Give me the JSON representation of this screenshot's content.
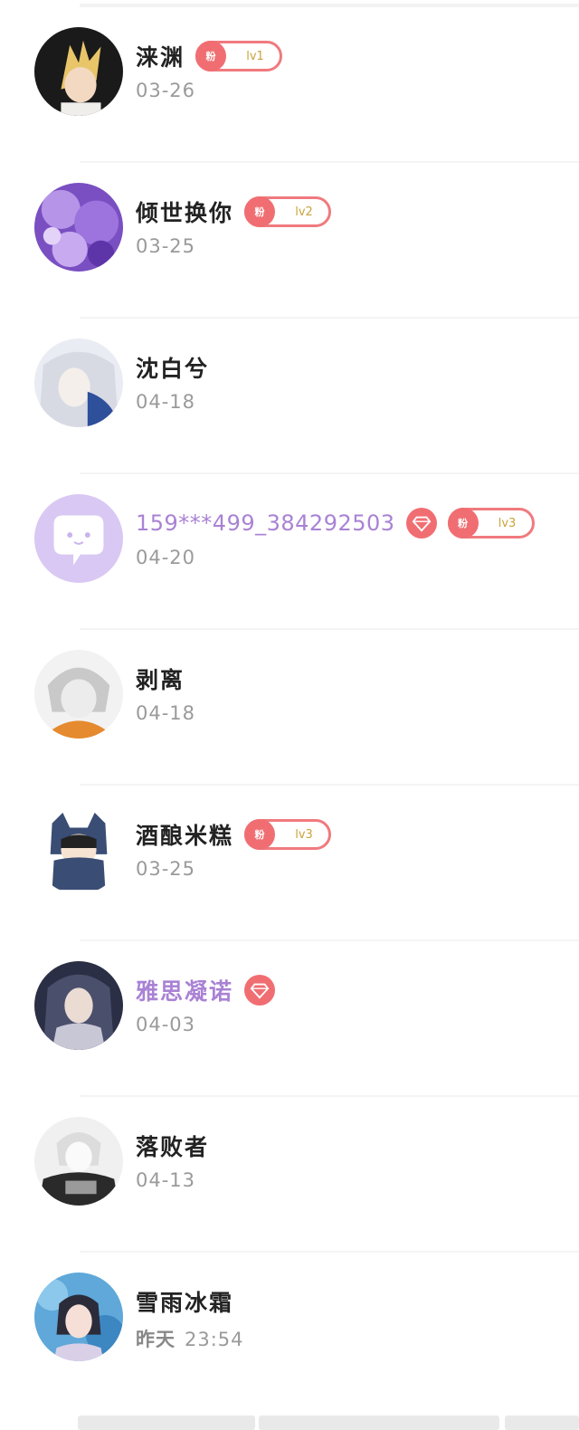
{
  "list": {
    "items": [
      {
        "name": "涞渊",
        "date": "03-26",
        "date_prefix": "",
        "fan_icon": "粉",
        "level": "lv1",
        "vip": false,
        "avatar": "avatar-blonde-anime"
      },
      {
        "name": "倾世换你",
        "date": "03-25",
        "date_prefix": "",
        "fan_icon": "粉",
        "level": "lv2",
        "vip": false,
        "avatar": "avatar-purple-blossoms"
      },
      {
        "name": "沈白兮",
        "date": "04-18",
        "date_prefix": "",
        "fan_icon": "",
        "level": "",
        "vip": false,
        "avatar": "avatar-white-hair-anime"
      },
      {
        "name": "159***499_384292503",
        "date": "04-20",
        "date_prefix": "",
        "fan_icon": "粉",
        "level": "lv3",
        "vip": true,
        "avatar": "avatar-default-chat-bubble"
      },
      {
        "name": "剥离",
        "date": "04-18",
        "date_prefix": "",
        "fan_icon": "",
        "level": "",
        "vip": false,
        "avatar": "avatar-grey-hair-anime"
      },
      {
        "name": "酒酿米糕",
        "date": "03-25",
        "date_prefix": "",
        "fan_icon": "粉",
        "level": "lv3",
        "vip": false,
        "avatar": "avatar-cat-hood-boy"
      },
      {
        "name": "雅思凝诺",
        "date": "04-03",
        "date_prefix": "",
        "fan_icon": "",
        "level": "",
        "vip": true,
        "avatar": "avatar-dark-hair-girl"
      },
      {
        "name": "落败者",
        "date": "04-13",
        "date_prefix": "",
        "fan_icon": "",
        "level": "",
        "vip": false,
        "avatar": "avatar-sketch-boy"
      },
      {
        "name": "雪雨冰霜",
        "date": "23:54",
        "date_prefix": "昨天",
        "fan_icon": "",
        "level": "",
        "vip": false,
        "avatar": "avatar-photo-girl"
      }
    ]
  },
  "colors": {
    "vip_name": "#a982d4",
    "badge": "#f06e72",
    "level_text": "#c9a43b",
    "date_text": "#9a9a9a"
  }
}
